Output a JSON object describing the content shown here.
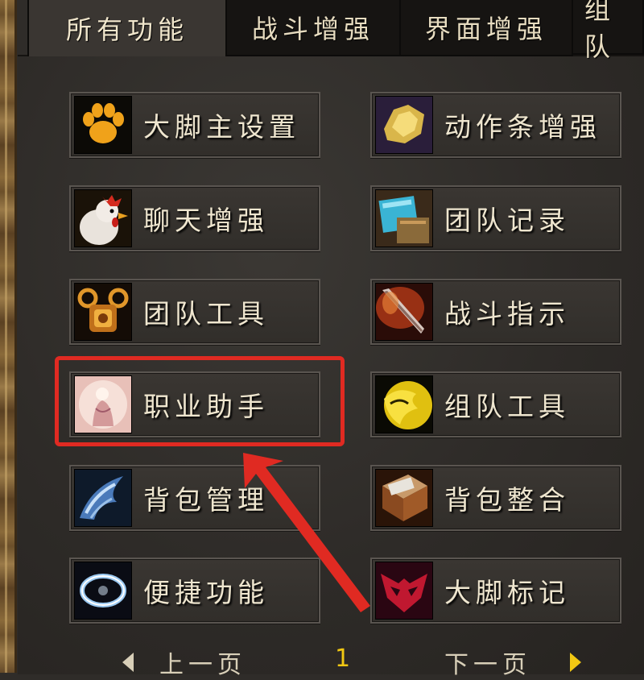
{
  "tabs": [
    {
      "label": "所有功能",
      "active": true
    },
    {
      "label": "战斗增强",
      "active": false
    },
    {
      "label": "界面增强",
      "active": false
    },
    {
      "label": "组队",
      "active": false
    }
  ],
  "buttons": [
    {
      "label": "大脚主设置",
      "icon": "paw-icon"
    },
    {
      "label": "动作条增强",
      "icon": "gold-gear-icon"
    },
    {
      "label": "聊天增强",
      "icon": "chicken-icon"
    },
    {
      "label": "团队记录",
      "icon": "scroll-book-icon"
    },
    {
      "label": "团队工具",
      "icon": "ornate-emblem-icon"
    },
    {
      "label": "战斗指示",
      "icon": "flaming-sword-icon"
    },
    {
      "label": "职业助手",
      "icon": "glowing-figure-icon"
    },
    {
      "label": "组队工具",
      "icon": "golden-beast-icon"
    },
    {
      "label": "背包管理",
      "icon": "blue-wings-icon"
    },
    {
      "label": "背包整合",
      "icon": "tome-icon"
    },
    {
      "label": "便捷功能",
      "icon": "light-ring-icon"
    },
    {
      "label": "大脚标记",
      "icon": "red-mask-icon"
    }
  ],
  "pager": {
    "prev_label": "上一页",
    "page_number": "1",
    "next_label": "下一页"
  },
  "annotation": {
    "highlight_color": "#e02a22"
  }
}
